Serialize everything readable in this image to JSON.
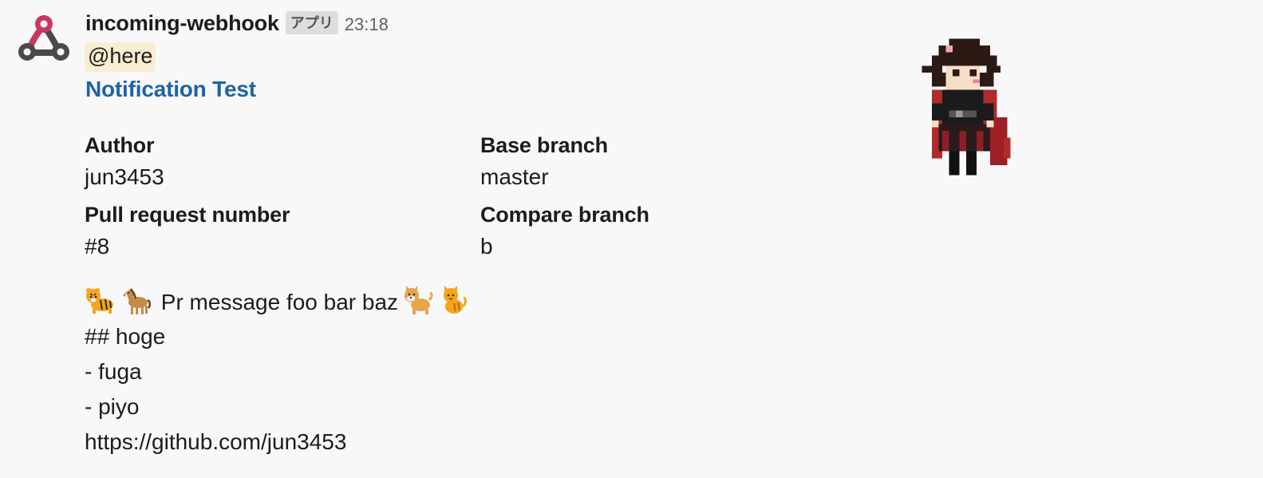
{
  "message": {
    "sender": "incoming-webhook",
    "app_badge": "アプリ",
    "timestamp": "23:18",
    "mention": "@here",
    "avatar_icon": "webhook-icon",
    "colors": {
      "link": "#1d64a6",
      "mention_bg": "#f9edd2",
      "text": "#1d1c1d",
      "timestamp": "#616061"
    }
  },
  "attachment": {
    "title": "Notification Test",
    "fields": [
      {
        "label": "Author",
        "value": "jun3453"
      },
      {
        "label": "Base branch",
        "value": "master"
      },
      {
        "label": "Pull request number",
        "value": "#8"
      },
      {
        "label": "Compare branch",
        "value": "b"
      }
    ],
    "body": {
      "first_line_emojis_before": [
        "tiger-icon",
        "horse-icon"
      ],
      "first_line_text": "Pr message foo bar baz",
      "first_line_emojis_after": [
        "dog-icon",
        "cat-icon"
      ],
      "lines": [
        "## hoge",
        "- fuga",
        "- piyo",
        "https://github.com/jun3453"
      ]
    },
    "thumbnail": "pixel-art-character-icon"
  }
}
